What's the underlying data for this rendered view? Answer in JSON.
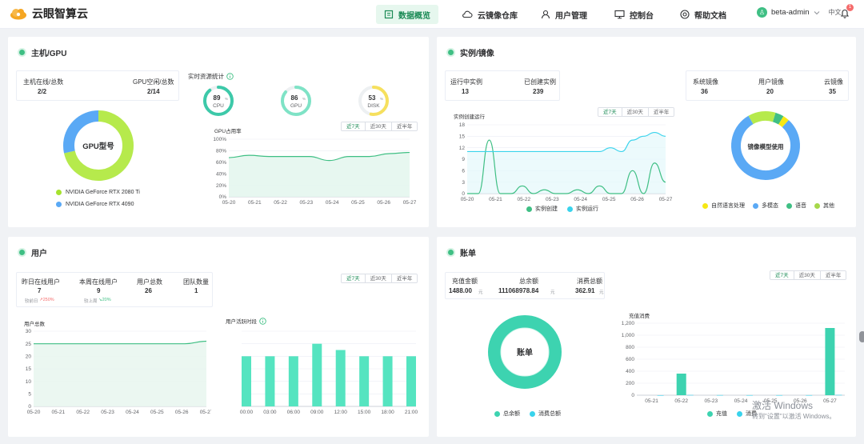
{
  "app": {
    "title": "云眼智算云"
  },
  "nav": [
    {
      "label": "数据概览",
      "icon": "dashboard-icon"
    },
    {
      "label": "云镜像仓库",
      "icon": "cloud-icon"
    },
    {
      "label": "用户管理",
      "icon": "user-icon"
    },
    {
      "label": "控制台",
      "icon": "monitor-icon"
    },
    {
      "label": "帮助文档",
      "icon": "help-icon"
    }
  ],
  "user": {
    "name": "beta-admin",
    "lang": "中文",
    "notif_count": "1"
  },
  "tabs": [
    "近7天",
    "近30天",
    "近半年"
  ],
  "host": {
    "title": "主机/GPU",
    "online_label": "主机在线/总数",
    "online_value": "2/2",
    "gpu_label": "GPU空闲/总数",
    "gpu_value": "2/14",
    "donut_label": "GPU型号",
    "legend": [
      {
        "name": "NVIDIA GeForce RTX 2080 Ti",
        "color": "#a6e22e"
      },
      {
        "name": "NVIDIA GeForce RTX 4090",
        "color": "#5aa9f5"
      }
    ],
    "realtime_label": "实时资源统计",
    "gauges": [
      {
        "value": "89",
        "unit": "%",
        "name": "CPU",
        "pct": 89,
        "color": "#3dc9a9"
      },
      {
        "value": "86",
        "unit": "%",
        "name": "GPU",
        "pct": 86,
        "color": "#7fe3c6"
      },
      {
        "value": "53",
        "unit": "%",
        "name": "DISK",
        "pct": 53,
        "color": "#f6e05e"
      }
    ],
    "usage_title": "GPU占用率"
  },
  "instance": {
    "title": "实例/镜像",
    "running_label": "运行中实例",
    "running_value": "13",
    "created_label": "已创建实例",
    "created_value": "239",
    "sys_label": "系统镜像",
    "sys_value": "36",
    "user_label": "用户镜像",
    "user_value": "20",
    "cloud_label": "云镜像",
    "cloud_value": "35",
    "trend_title": "实例创建运行",
    "donut_label": "镜像模型使用",
    "legend": [
      {
        "name": "自然语言处理",
        "color": "#f6e814"
      },
      {
        "name": "多模态",
        "color": "#5aa9f5"
      },
      {
        "name": "语音",
        "color": "#3fbf84"
      },
      {
        "name": "其他",
        "color": "#a6d84a"
      }
    ],
    "series_legend": [
      {
        "name": "实例创建",
        "color": "#3fbf84"
      },
      {
        "name": "实例运行",
        "color": "#39d3ec"
      }
    ]
  },
  "users": {
    "title": "用户",
    "stats": [
      {
        "label": "昨日在线用户",
        "value": "7",
        "sub": "较前日",
        "delta": "↗250%",
        "delta_color": "#f56c6c"
      },
      {
        "label": "本周在线用户",
        "value": "9",
        "sub": "较上周",
        "delta": "↘20%",
        "delta_color": "#3fbf84"
      },
      {
        "label": "用户总数",
        "value": "26",
        "sub": "",
        "delta": "",
        "delta_color": "#909399"
      },
      {
        "label": "团队数量",
        "value": "1",
        "sub": "",
        "delta": "",
        "delta_color": "#909399"
      }
    ],
    "total_title": "用户总数",
    "active_title": "用户活跃时段"
  },
  "billing": {
    "title": "账单",
    "recharge_label": "充值金额",
    "recharge_value": "1488.00",
    "recharge_unit": "元",
    "balance_label": "总余额",
    "balance_value": "111068978.84",
    "balance_unit": "元",
    "consume_label": "消费总额",
    "consume_value": "362.91",
    "consume_unit": "元",
    "donut_label": "账单",
    "legend": [
      {
        "name": "总余额",
        "color": "#3dd3b0"
      },
      {
        "name": "消费总额",
        "color": "#39d3ec"
      }
    ],
    "bar_title": "充值消费",
    "bar_legend": [
      {
        "name": "充值",
        "color": "#3dd3b0"
      },
      {
        "name": "消费",
        "color": "#39d3ec"
      }
    ]
  },
  "watermark": {
    "line1": "激活 Windows",
    "line2": "转到\"设置\"以激活 Windows。"
  },
  "chart_data": [
    {
      "type": "area",
      "title": "GPU占用率",
      "categories": [
        "05-20",
        "05-21",
        "05-22",
        "05-23",
        "05-24",
        "05-25",
        "05-26",
        "05-27"
      ],
      "y_ticks": [
        "0%",
        "20%",
        "40%",
        "60%",
        "80%",
        "100%"
      ],
      "ylim": [
        0,
        100
      ],
      "series": [
        {
          "values": [
            68,
            72,
            70,
            70,
            70,
            63,
            70,
            70,
            75,
            77
          ]
        }
      ]
    },
    {
      "type": "line",
      "title": "实例创建运行",
      "categories": [
        "05-20",
        "05-21",
        "05-22",
        "05-23",
        "05-24",
        "05-25",
        "05-26",
        "05-27"
      ],
      "y_ticks": [
        "0",
        "3",
        "6",
        "9",
        "12",
        "15",
        "18"
      ],
      "ylim": [
        0,
        18
      ],
      "series": [
        {
          "name": "实例创建",
          "values": [
            0,
            0,
            14,
            0,
            0,
            2,
            0,
            1,
            0,
            0,
            1,
            0,
            2,
            0,
            0,
            6,
            0,
            8,
            3
          ]
        },
        {
          "name": "实例运行",
          "values": [
            11,
            11,
            11,
            11,
            11,
            11,
            11,
            11,
            11,
            11,
            11,
            11,
            11,
            12,
            11,
            14,
            15,
            16,
            15
          ]
        }
      ]
    },
    {
      "type": "area",
      "title": "用户总数",
      "categories": [
        "05-20",
        "05-21",
        "05-22",
        "05-23",
        "05-24",
        "05-25",
        "05-26",
        "05-27"
      ],
      "y_ticks": [
        "0",
        "5",
        "10",
        "15",
        "20",
        "25",
        "30"
      ],
      "ylim": [
        0,
        30
      ],
      "series": [
        {
          "values": [
            25,
            25,
            25,
            25,
            25,
            25,
            25,
            25,
            26
          ]
        }
      ]
    },
    {
      "type": "bar",
      "title": "用户活跃时段",
      "categories": [
        "00:00",
        "03:00",
        "06:00",
        "09:00",
        "12:00",
        "15:00",
        "18:00",
        "21:00"
      ],
      "ylim": [
        0,
        12
      ],
      "series": [
        {
          "values": [
            8,
            8,
            8,
            8,
            8,
            8,
            8,
            10,
            8,
            9,
            8,
            8,
            8,
            8,
            8
          ]
        }
      ]
    },
    {
      "type": "bar",
      "title": "充值消费",
      "categories": [
        "05-21",
        "05-22",
        "05-23",
        "05-24",
        "05-25",
        "05-26",
        "05-27"
      ],
      "y_ticks": [
        "0",
        "200",
        "400",
        "600",
        "800",
        "1,000",
        "1,200"
      ],
      "ylim": [
        0,
        1200
      ],
      "series": [
        {
          "name": "充值",
          "values": [
            0,
            360,
            0,
            0,
            0,
            0,
            1120
          ]
        },
        {
          "name": "消费",
          "values": [
            0,
            4,
            2,
            1,
            1,
            1,
            5
          ]
        }
      ]
    },
    {
      "type": "pie",
      "title": "GPU型号",
      "series": [
        {
          "name": "NVIDIA GeForce RTX 2080 Ti",
          "values": [
            10
          ]
        },
        {
          "name": "NVIDIA GeForce RTX 4090",
          "values": [
            4
          ]
        }
      ]
    },
    {
      "type": "pie",
      "title": "镜像模型使用",
      "series": [
        {
          "name": "自然语言处理",
          "values": [
            3
          ]
        },
        {
          "name": "多模态",
          "values": [
            80
          ]
        },
        {
          "name": "语音",
          "values": [
            4
          ]
        },
        {
          "name": "其他",
          "values": [
            13
          ]
        }
      ]
    },
    {
      "type": "pie",
      "title": "账单",
      "series": [
        {
          "name": "总余额",
          "values": [
            100
          ]
        },
        {
          "name": "消费总额",
          "values": [
            0
          ]
        }
      ]
    }
  ]
}
